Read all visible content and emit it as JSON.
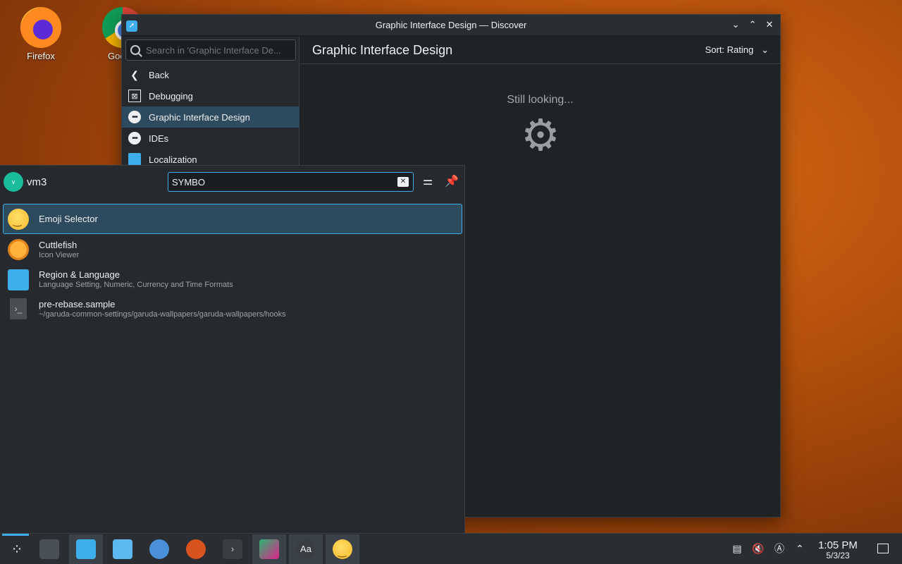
{
  "desktop": {
    "icons": [
      {
        "label": "Firefox"
      },
      {
        "label": "Google"
      }
    ]
  },
  "discover": {
    "window_title": "Graphic Interface Design — Discover",
    "search_placeholder": "Search in 'Graphic Interface De...",
    "nav": [
      {
        "label": "Back",
        "icon": "back-arrow-icon"
      },
      {
        "label": "Debugging",
        "icon": "debug-icon"
      },
      {
        "label": "Graphic Interface Design",
        "icon": "more-dots-icon",
        "active": true
      },
      {
        "label": "IDEs",
        "icon": "more-dots-icon"
      },
      {
        "label": "Localization",
        "icon": "localization-icon"
      }
    ],
    "page_title": "Graphic Interface Design",
    "sort_label": "Sort: Rating",
    "status_text": "Still looking..."
  },
  "launcher": {
    "avatar_letter": "v",
    "username": "vm3",
    "query": "SYMBO",
    "results": [
      {
        "name": "Emoji Selector",
        "subtitle": "",
        "icon": "emoji-icon",
        "selected": true
      },
      {
        "name": "Cuttlefish",
        "subtitle": "Icon Viewer",
        "icon": "cuttlefish-icon"
      },
      {
        "name": "Region & Language",
        "subtitle": "Language Setting, Numeric, Currency and Time Formats",
        "icon": "region-icon"
      },
      {
        "name": "pre-rebase.sample",
        "subtitle": "~/garuda-common-settings/garuda-wallpapers/garuda-wallpapers/hooks",
        "icon": "script-icon"
      }
    ]
  },
  "taskbar": {
    "apps": [
      "application-launcher-icon",
      "settings-sliders-icon",
      "discover-icon",
      "file-manager-icon",
      "system-settings-icon",
      "garuda-icon",
      "terminal-icon",
      "ide-icon",
      "font-viewer-icon",
      "emoji-icon"
    ],
    "font_viewer_label": "Aa",
    "time": "1:05 PM",
    "date": "5/3/23"
  },
  "colors": {
    "accent": "#3daee9",
    "selection": "#2e4a5e",
    "window_bg": "#202326"
  }
}
